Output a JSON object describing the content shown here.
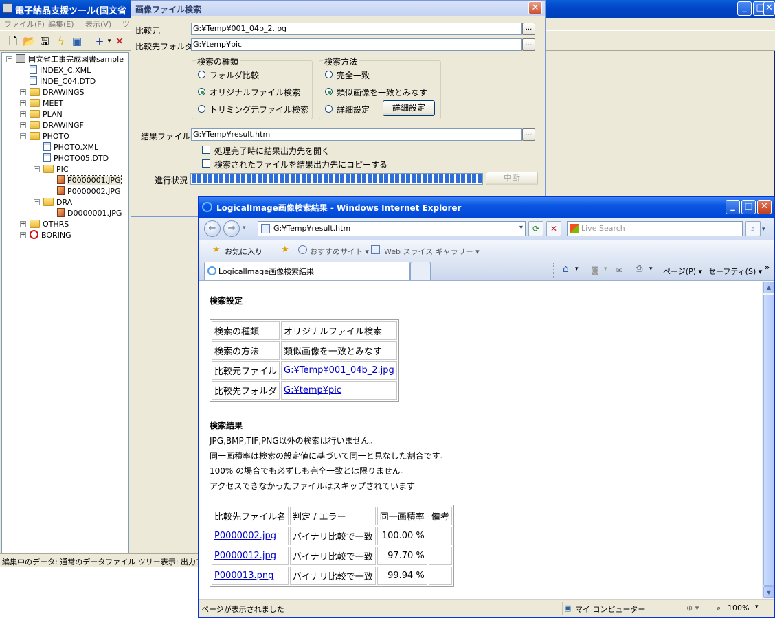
{
  "app": {
    "title": "電子納品支援ツール(国文省",
    "menu": [
      "ファイル(F)",
      "編集(E)",
      "表示(V)",
      "ツ"
    ],
    "status": "編集中のデータ: 通常のデータファイル  ツリー表示: 出力ファイ",
    "tree": [
      {
        "label": "国文省工事完成図書sample",
        "icon": "pc-icon",
        "depth": 0,
        "expander": "−"
      },
      {
        "label": "INDEX_C.XML",
        "icon": "xml-file-icon",
        "depth": 1,
        "expander": ""
      },
      {
        "label": "INDE_C04.DTD",
        "icon": "xml-file-icon",
        "depth": 1,
        "expander": ""
      },
      {
        "label": "DRAWINGS",
        "icon": "folder-icon",
        "depth": 1,
        "expander": "+"
      },
      {
        "label": "MEET",
        "icon": "folder-icon",
        "depth": 1,
        "expander": "+"
      },
      {
        "label": "PLAN",
        "icon": "folder-icon",
        "depth": 1,
        "expander": "+"
      },
      {
        "label": "DRAWINGF",
        "icon": "folder-icon",
        "depth": 1,
        "expander": "+"
      },
      {
        "label": "PHOTO",
        "icon": "folder-icon",
        "depth": 1,
        "expander": "−"
      },
      {
        "label": "PHOTO.XML",
        "icon": "xml-file-icon",
        "depth": 2,
        "expander": ""
      },
      {
        "label": "PHOTO05.DTD",
        "icon": "xml-file-icon",
        "depth": 2,
        "expander": ""
      },
      {
        "label": "PIC",
        "icon": "folder-icon",
        "depth": 2,
        "expander": "−"
      },
      {
        "label": "P0000001.JPG",
        "icon": "image-file-icon",
        "depth": 3,
        "expander": "",
        "selected": true
      },
      {
        "label": "P0000002.JPG",
        "icon": "image-file-icon",
        "depth": 3,
        "expander": ""
      },
      {
        "label": "DRA",
        "icon": "folder-icon",
        "depth": 2,
        "expander": "−"
      },
      {
        "label": "D0000001.JPG",
        "icon": "image-file-icon",
        "depth": 3,
        "expander": ""
      },
      {
        "label": "OTHRS",
        "icon": "folder-icon",
        "depth": 1,
        "expander": "+"
      },
      {
        "label": "BORING",
        "icon": "prohibited-icon",
        "depth": 1,
        "expander": "+"
      }
    ]
  },
  "dialog": {
    "title": "画像ファイル検索",
    "source_label": "比較元",
    "source_value": "G:¥Temp¥001_04b_2.jpg",
    "target_label": "比較先フォルダ",
    "target_value": "G:¥temp¥pic",
    "browse": "...",
    "search_type": {
      "legend": "検索の種類",
      "options": [
        "フォルダ比較",
        "オリジナルファイル検索",
        "トリミング元ファイル検索"
      ],
      "selected": 1
    },
    "search_method": {
      "legend": "検索方法",
      "options": [
        "完全一致",
        "類似画像を一致とみなす",
        "詳細設定"
      ],
      "selected": 1,
      "detail_button": "詳細設定"
    },
    "result_label": "結果ファイル",
    "result_value": "G:¥Temp¥result.htm",
    "open_on_finish": "処理完了時に結果出力先を開く",
    "copy_found": "検索されたファイルを結果出力先にコピーする",
    "progress_label": "進行状況",
    "progress": 1.0,
    "abort_button": "中断"
  },
  "ie": {
    "title": "LogicalImage画像検索結果 - Windows Internet Explorer",
    "address": "G:¥Temp¥result.htm",
    "search_placeholder": "Live Search",
    "favorites": "お気に入り",
    "suggested": "おすすめサイト ▾",
    "webslice": "Web スライス ギャラリー ▾",
    "tab": "LogicalImage画像検索結果",
    "commands": {
      "page": "ページ(P) ▾",
      "safety": "セーフティ(S) ▾"
    },
    "status": "ページが表示されました",
    "zone": "マイ コンピューター",
    "zoom": "100%",
    "content": {
      "settings_heading": "検索設定",
      "settings": [
        {
          "key": "検索の種類",
          "value": "オリジナルファイル検索",
          "link": false
        },
        {
          "key": "検索の方法",
          "value": "類似画像を一致とみなす",
          "link": false
        },
        {
          "key": "比較元ファイル",
          "value": "G:¥Temp¥001_04b_2.jpg",
          "link": true
        },
        {
          "key": "比較先フォルダ",
          "value": "G:¥temp¥pic",
          "link": true
        }
      ],
      "results_heading": "検索結果",
      "notes": [
        "JPG,BMP,TIF,PNG以外の検索は行いません。",
        "同一画積率は検索の設定値に基づいて同一と見なした割合です。",
        "100% の場合でも必ずしも完全一致とは限りません。",
        "アクセスできなかったファイルはスキップされています"
      ],
      "columns": [
        "比較先ファイル名",
        "判定 / エラー",
        "同一画積率",
        "備考"
      ],
      "rows": [
        {
          "file": "P0000002.jpg",
          "judge": "バイナリ比較で一致",
          "rate": "100.00 %",
          "note": ""
        },
        {
          "file": "P0000012.jpg",
          "judge": "バイナリ比較で一致",
          "rate": "97.70 %",
          "note": ""
        },
        {
          "file": "P000013.png",
          "judge": "バイナリ比較で一致",
          "rate": "99.94 %",
          "note": ""
        }
      ]
    }
  }
}
